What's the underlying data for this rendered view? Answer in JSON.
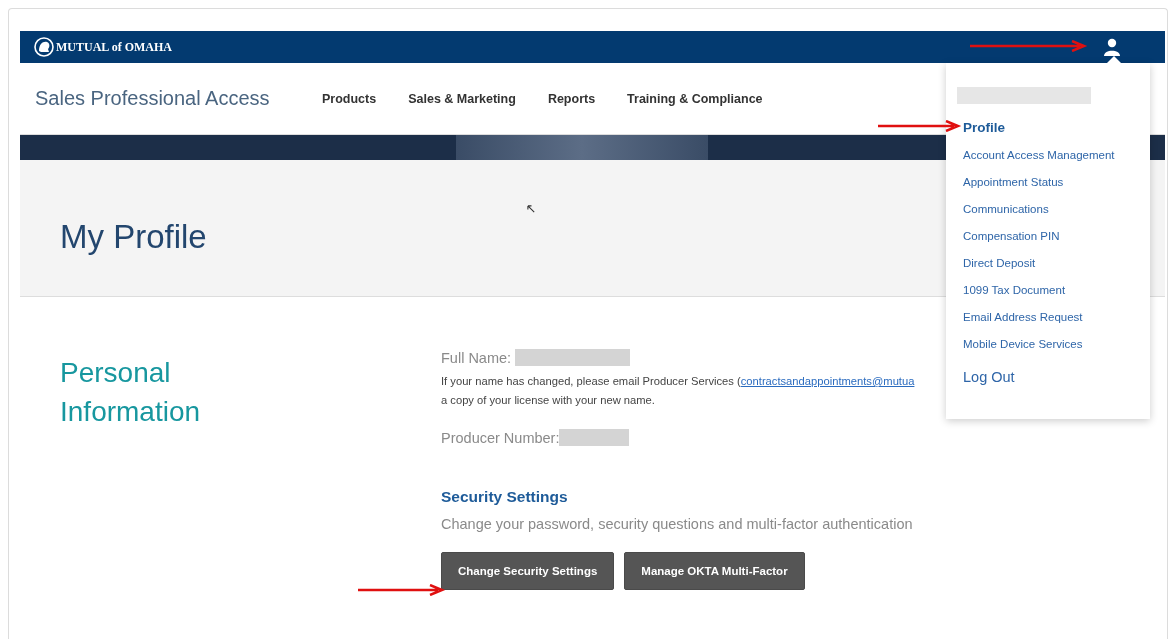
{
  "logo": {
    "text": "MUTUAL of OMAHA"
  },
  "site_title": "Sales Professional Access",
  "nav": [
    {
      "label": "Products"
    },
    {
      "label": "Sales & Marketing"
    },
    {
      "label": "Reports"
    },
    {
      "label": "Training & Compliance"
    }
  ],
  "page_title": "My Profile",
  "section_title": "Personal Information",
  "profile": {
    "full_name_label": "Full Name:",
    "note_before": "If your name has changed, please email Producer Services (",
    "note_link": "contractsandappointments@mutua",
    "note_after": "a copy of your license with your new name.",
    "producer_label": "Producer Number:"
  },
  "security": {
    "title": "Security Settings",
    "description": "Change your password, security questions and multi-factor authentication",
    "buttons": [
      "Change Security Settings",
      "Manage OKTA Multi-Factor"
    ]
  },
  "user_menu": {
    "items": [
      {
        "label": "Profile",
        "selected": true,
        "kind": "link"
      },
      {
        "label": "Account Access Management",
        "selected": false,
        "kind": "link"
      },
      {
        "label": "Appointment Status",
        "selected": false,
        "kind": "link"
      },
      {
        "label": "Communications",
        "selected": false,
        "kind": "link"
      },
      {
        "label": "Compensation PIN",
        "selected": false,
        "kind": "link"
      },
      {
        "label": "Direct Deposit",
        "selected": false,
        "kind": "link"
      },
      {
        "label": "1099 Tax Document",
        "selected": false,
        "kind": "link"
      },
      {
        "label": "Email Address Request",
        "selected": false,
        "kind": "link"
      },
      {
        "label": "Mobile Device Services",
        "selected": false,
        "kind": "link"
      },
      {
        "label": "Log Out",
        "selected": false,
        "kind": "logout"
      }
    ]
  }
}
